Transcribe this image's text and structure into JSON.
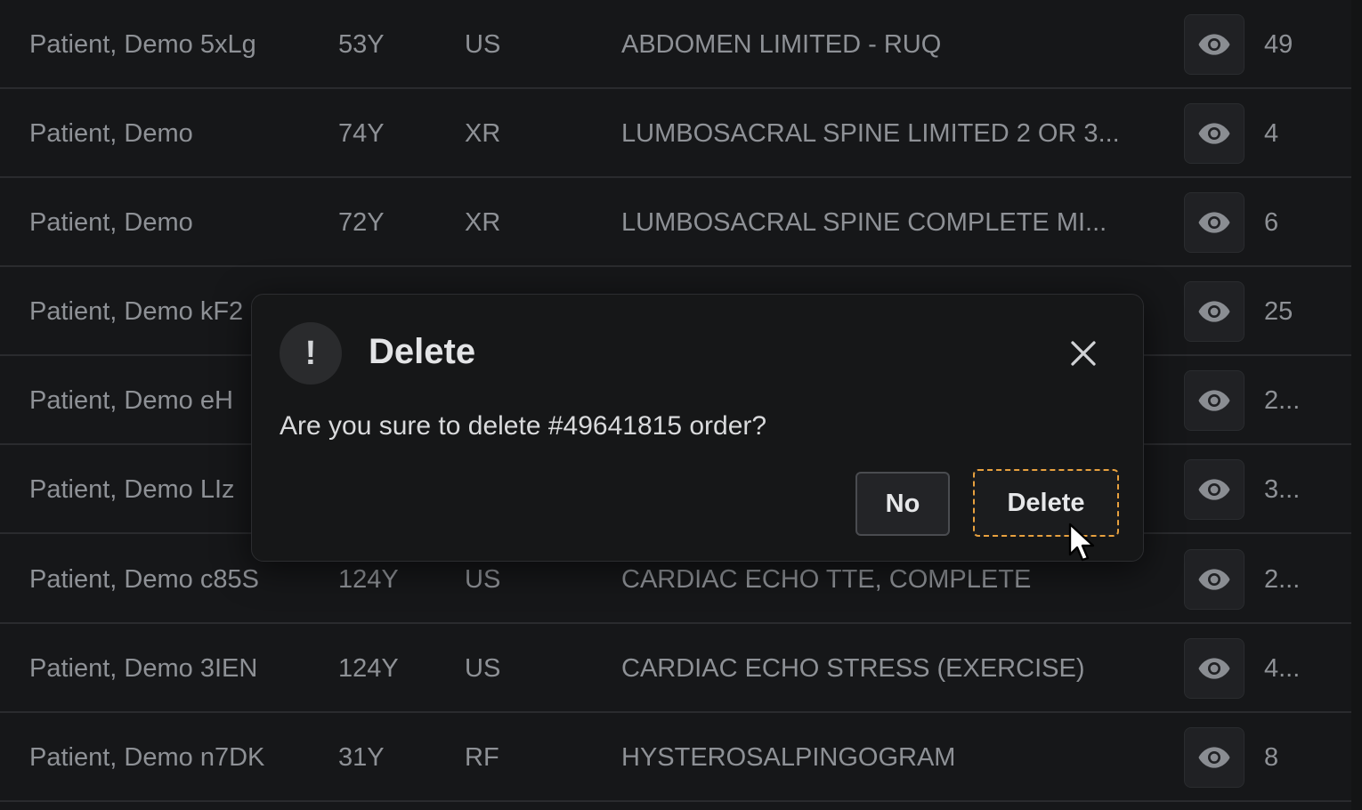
{
  "rows": [
    {
      "name": "Patient, Demo 5xLg",
      "age": "53Y",
      "modality": "US",
      "description": "ABDOMEN LIMITED - RUQ",
      "count": "49"
    },
    {
      "name": "Patient, Demo",
      "age": "74Y",
      "modality": "XR",
      "description": "LUMBOSACRAL SPINE LIMITED 2 OR 3...",
      "count": "4"
    },
    {
      "name": "Patient, Demo",
      "age": "72Y",
      "modality": "XR",
      "description": "LUMBOSACRAL SPINE COMPLETE MI...",
      "count": "6"
    },
    {
      "name": "Patient, Demo kF2",
      "age": "",
      "modality": "",
      "description": "",
      "count": "25"
    },
    {
      "name": "Patient, Demo eH",
      "age": "",
      "modality": "",
      "description": "",
      "count": "2..."
    },
    {
      "name": "Patient, Demo LIz",
      "age": "",
      "modality": "",
      "description": "",
      "count": "3..."
    },
    {
      "name": "Patient, Demo c85S",
      "age": "124Y",
      "modality": "US",
      "description": "CARDIAC ECHO TTE, COMPLETE",
      "count": "2..."
    },
    {
      "name": "Patient, Demo 3IEN",
      "age": "124Y",
      "modality": "US",
      "description": "CARDIAC ECHO STRESS (EXERCISE)",
      "count": "4..."
    },
    {
      "name": "Patient, Demo n7DK",
      "age": "31Y",
      "modality": "RF",
      "description": "HYSTEROSALPINGOGRAM",
      "count": "8"
    }
  ],
  "row_action_icon": "eye-icon",
  "modal": {
    "icon_glyph": "!",
    "title": "Delete",
    "message": "Are you sure to delete #49641815 order?",
    "no_label": "No",
    "delete_label": "Delete",
    "close_icon": "close-icon"
  },
  "colors": {
    "background": "#161719",
    "row_text": "#8e9196",
    "focus_outline": "#e8a13f"
  }
}
